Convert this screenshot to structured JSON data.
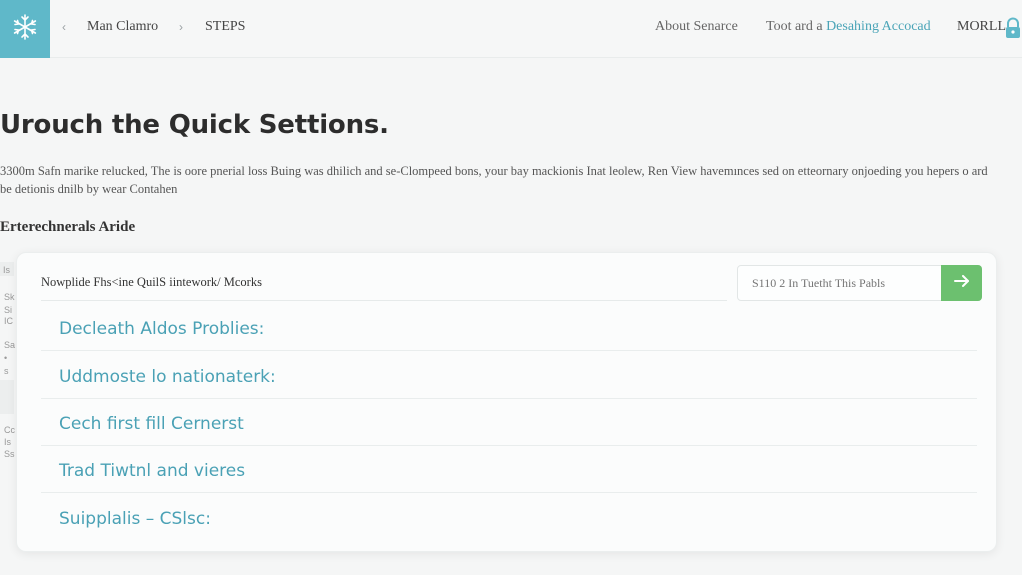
{
  "header": {
    "breadcrumb": [
      "Man Clamro",
      "STEPS"
    ],
    "nav": {
      "about": "About Senarce",
      "toot_prefix": "Toot ard a ",
      "toot_accent": "Desahing Accocad",
      "more": "MORLL"
    },
    "icons": {
      "logo": "snowflake-icon",
      "lock": "lock-icon"
    }
  },
  "main": {
    "title": "Urouch the Quick Settions.",
    "description": "3300m Safn marike relucked, The is oore pnerial loss Buing was dhilich and se-Clompeed bons, your bay mackionis Inat leolew, Ren View havemınces sed on etteornary onjoeding you hepers o ard be detionis dnilb by wear Contahen",
    "section_title": "Erterechnerals Aride"
  },
  "sidebar_fragments": [
    "Is",
    "Sk",
    "Si",
    "IC",
    "Sa",
    "• s",
    "Cc",
    "Is",
    "Ss"
  ],
  "card": {
    "heading": "Nowplide Fhs<ine QuilS iintework/ Mcorks",
    "search": {
      "placeholder": "S110 2 In Tuetht This Pabls",
      "icon": "arrow-right-icon"
    },
    "items": [
      "Decleath Aldos Problies:",
      "Uddmoste lo nationaterk:",
      "Cech first fill Cernerst",
      "Trad Tiwtnl and vieres",
      "Suipplalis – CSlsc:"
    ]
  },
  "colors": {
    "accent": "#4aa1b5",
    "logo_bg": "#5fb8c9",
    "button_green": "#6cc06f",
    "background": "#f5f6f6"
  }
}
